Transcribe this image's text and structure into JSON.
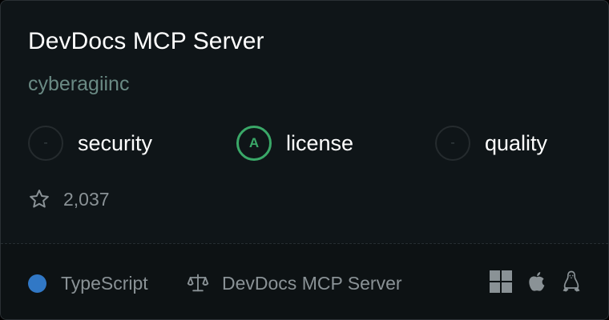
{
  "card": {
    "title": "DevDocs MCP Server",
    "owner": "cyberagiinc",
    "scores": [
      {
        "grade": "-",
        "label": "security"
      },
      {
        "grade": "A",
        "label": "license"
      },
      {
        "grade": "-",
        "label": "quality"
      }
    ],
    "stars": "2,037",
    "language": "TypeScript",
    "language_color": "#3178c6",
    "license_name": "DevDocs MCP Server",
    "platforms": [
      "windows-icon",
      "apple-icon",
      "linux-icon"
    ],
    "accent_color": "#3aa868"
  }
}
